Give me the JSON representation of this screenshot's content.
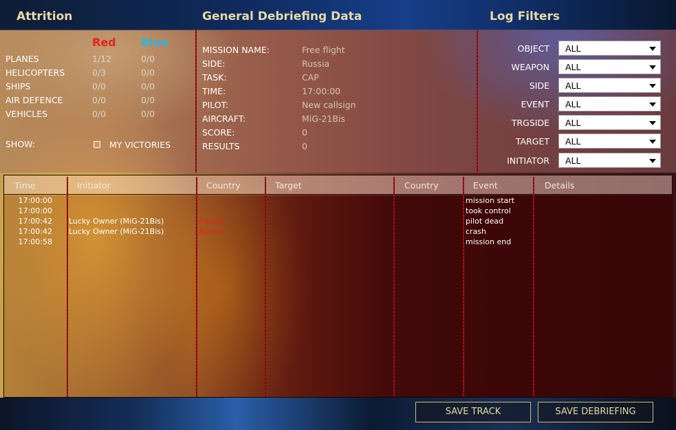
{
  "header": {
    "attrition_title": "Attrition",
    "general_title": "General Debriefing Data",
    "filters_title": "Log Filters"
  },
  "attrition": {
    "red_label": "Red",
    "blue_label": "Blue",
    "rows": [
      {
        "label": "PLANES",
        "red": "1/12",
        "blue": "0/0"
      },
      {
        "label": "HELICOPTERS",
        "red": "0/3",
        "blue": "0/0"
      },
      {
        "label": "SHIPS",
        "red": "0/0",
        "blue": "0/0"
      },
      {
        "label": "AIR DEFENCE",
        "red": "0/0",
        "blue": "0/0"
      },
      {
        "label": "VEHICLES",
        "red": "0/0",
        "blue": "0/0"
      }
    ],
    "show_label": "SHOW:",
    "my_victories_label": "MY VICTORIES"
  },
  "general": {
    "rows": [
      {
        "label": "MISSION NAME:",
        "value": "Free flight"
      },
      {
        "label": "SIDE:",
        "value": "Russia"
      },
      {
        "label": "TASK:",
        "value": "CAP"
      },
      {
        "label": "TIME:",
        "value": "17:00:00"
      },
      {
        "label": "PILOT:",
        "value": "New callsign"
      },
      {
        "label": "AIRCRAFT:",
        "value": "MiG-21Bis"
      },
      {
        "label": "SCORE:",
        "value": "0"
      },
      {
        "label": "RESULTS",
        "value": "0"
      }
    ]
  },
  "filters": [
    {
      "label": "OBJECT",
      "value": "ALL"
    },
    {
      "label": "WEAPON",
      "value": "ALL"
    },
    {
      "label": "SIDE",
      "value": "ALL"
    },
    {
      "label": "EVENT",
      "value": "ALL"
    },
    {
      "label": "TRGSIDE",
      "value": "ALL"
    },
    {
      "label": "TARGET",
      "value": "ALL"
    },
    {
      "label": "INITIATOR",
      "value": "ALL"
    }
  ],
  "log": {
    "columns": [
      "Time",
      "Initiator",
      "Country",
      "Target",
      "Country",
      "Event",
      "Details"
    ],
    "rows": [
      {
        "time": "17:00:00",
        "initiator": "",
        "country": "",
        "target": "",
        "target_country": "",
        "event": "mission start",
        "details": ""
      },
      {
        "time": "17:00:00",
        "initiator": "",
        "country": "",
        "target": "",
        "target_country": "",
        "event": "took control",
        "details": ""
      },
      {
        "time": "17:00:42",
        "initiator": "Lucky Owner (MiG-21Bis)",
        "country": "Russia",
        "target": "",
        "target_country": "",
        "event": "pilot dead",
        "details": ""
      },
      {
        "time": "17:00:42",
        "initiator": "Lucky Owner (MiG-21Bis)",
        "country": "Russia",
        "target": "",
        "target_country": "",
        "event": "crash",
        "details": ""
      },
      {
        "time": "17:00:58",
        "initiator": "",
        "country": "",
        "target": "",
        "target_country": "",
        "event": "mission end",
        "details": ""
      }
    ]
  },
  "actions": {
    "save_track": "SAVE TRACK",
    "save_debriefing": "SAVE DEBRIEFING"
  },
  "colors": {
    "red_side": "#e3221d",
    "blue_side": "#2fb3e0",
    "title": "#e8d9a6",
    "divider": "#a3111a"
  }
}
